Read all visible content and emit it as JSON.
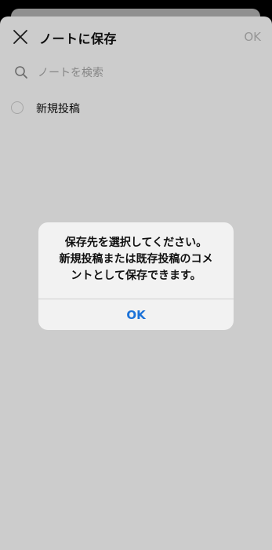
{
  "header": {
    "title": "ノートに保存",
    "ok_label": "OK",
    "close_icon": "close-icon"
  },
  "search": {
    "placeholder": "ノートを検索",
    "value": "",
    "icon": "search-icon"
  },
  "notes": [
    {
      "label": "新規投稿",
      "selected": false
    }
  ],
  "dialog": {
    "lines": [
      "保存先を選択してください。",
      "新規投稿または既存投稿のコメ",
      "ントとして保存できます。"
    ],
    "ok_label": "OK"
  },
  "colors": {
    "accent": "#1b72d8",
    "disabled_text": "#bcbcbc"
  }
}
